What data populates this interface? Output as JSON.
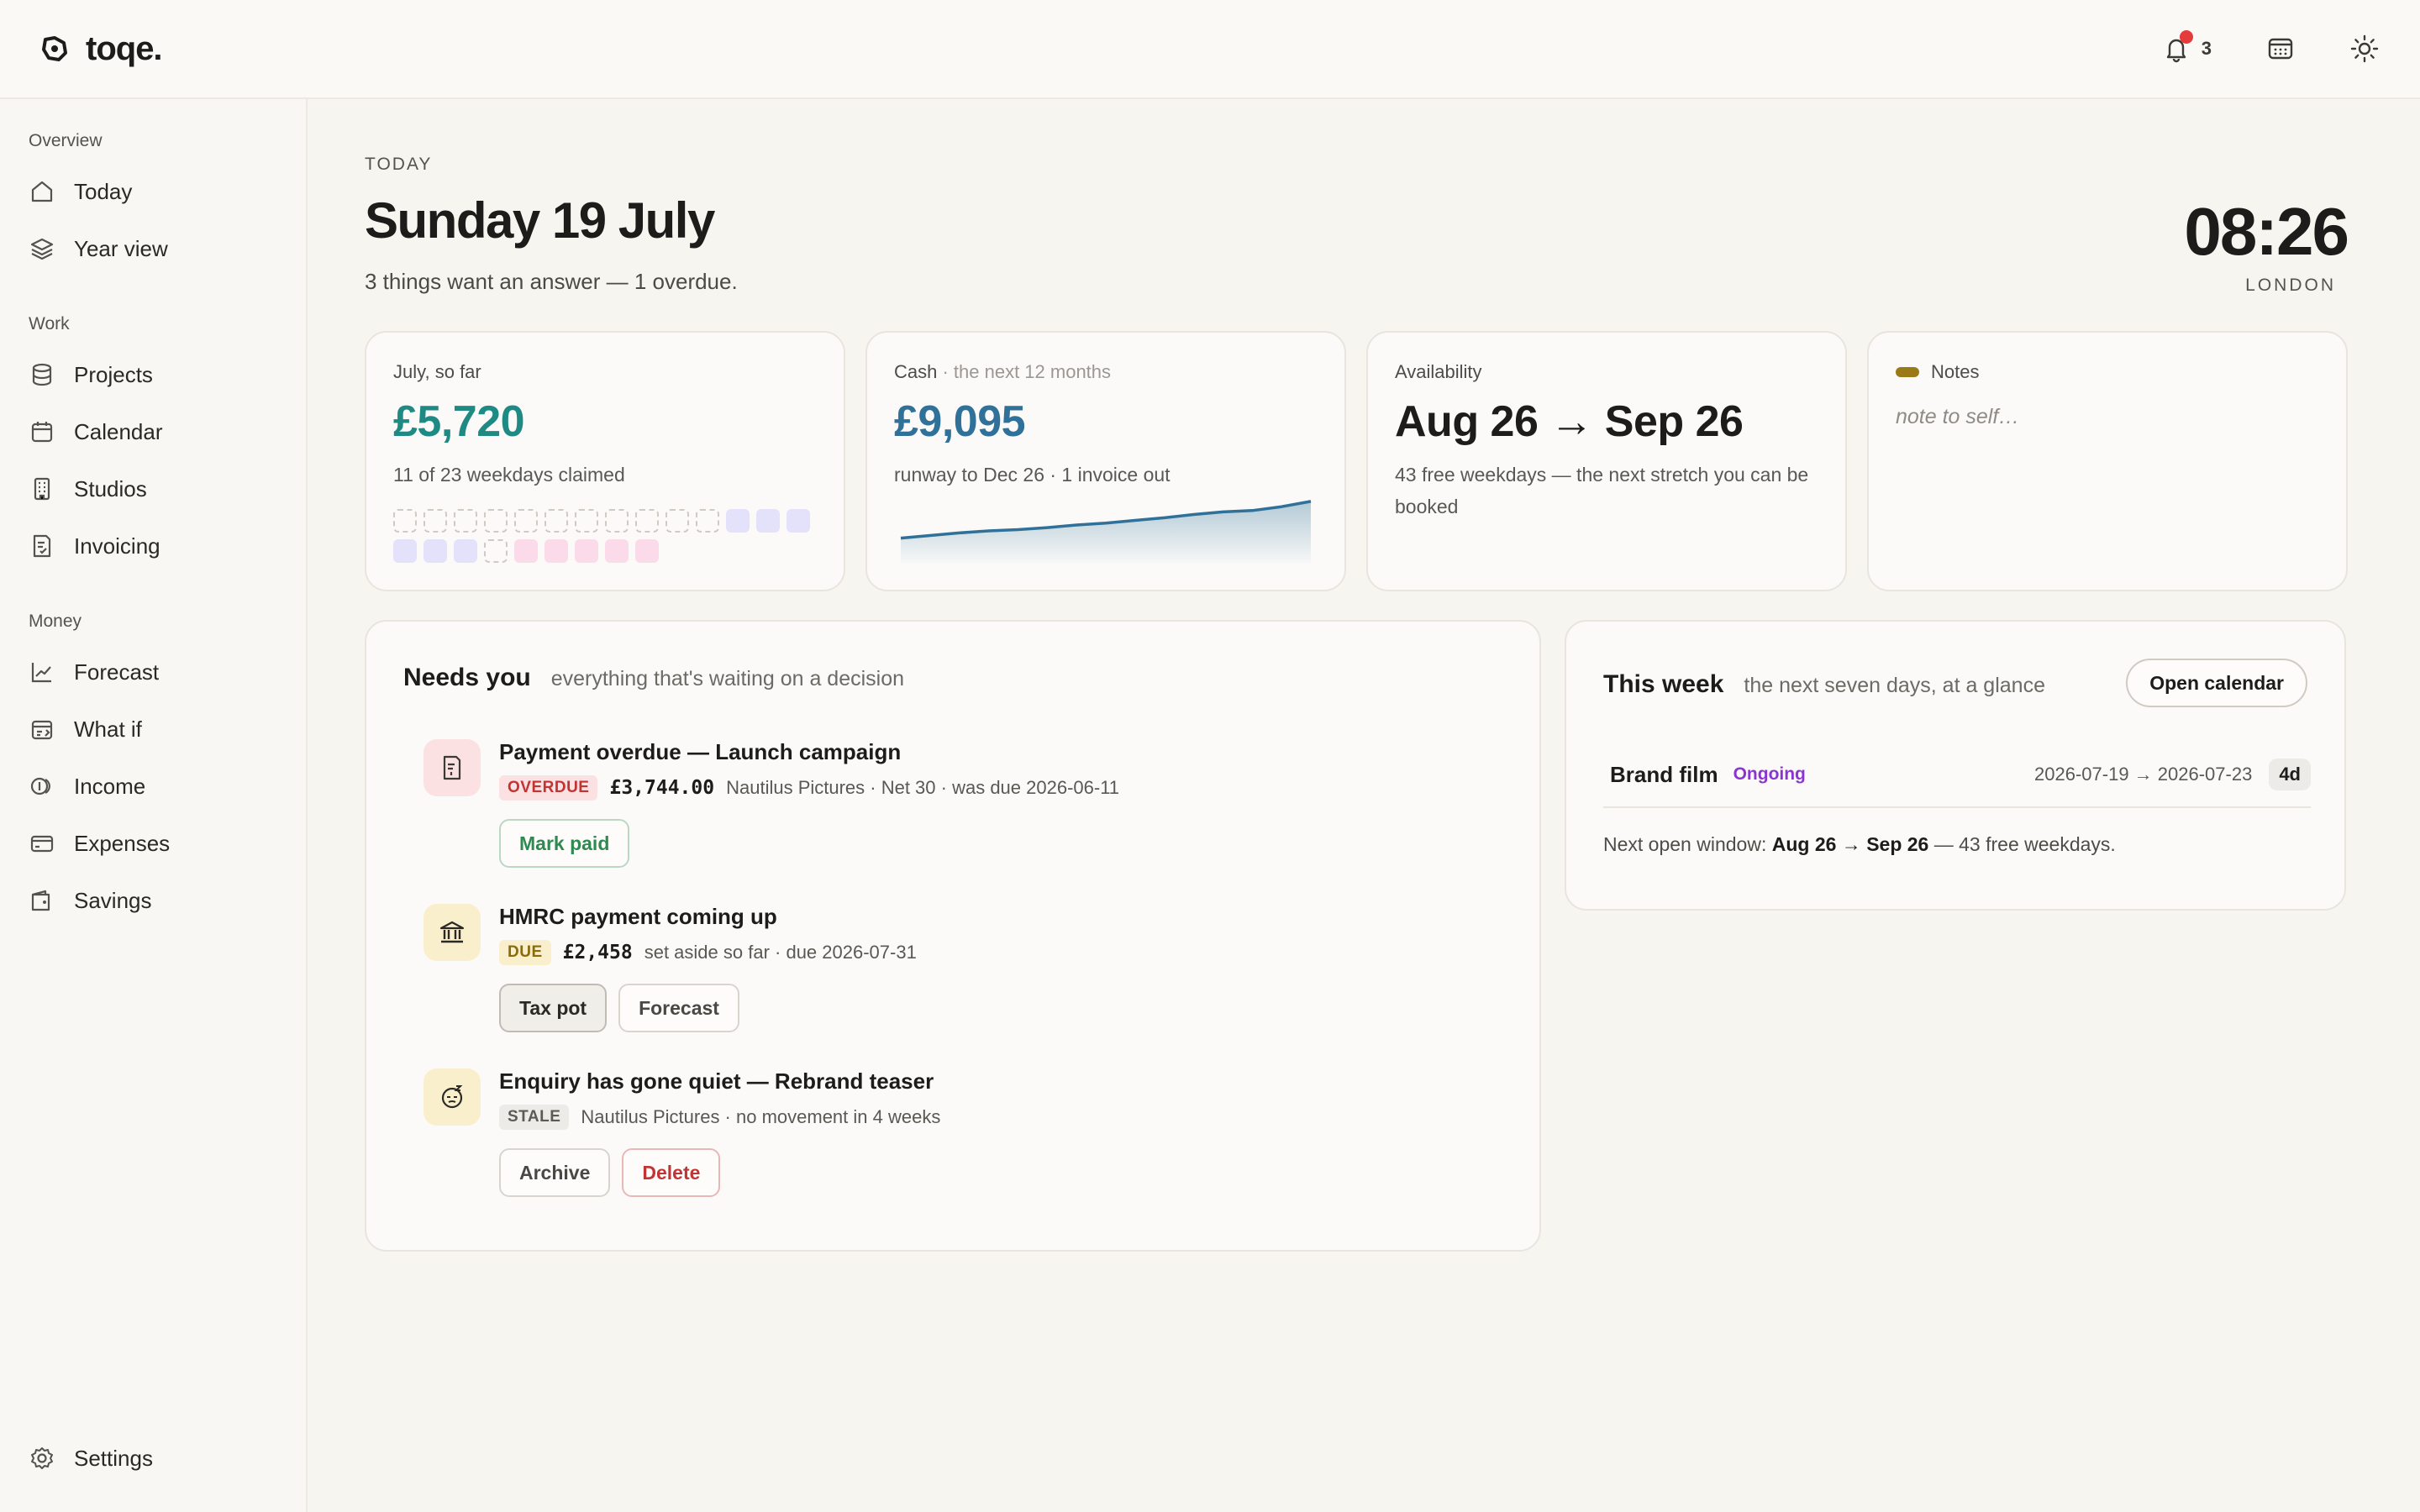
{
  "app": {
    "name": "toqe."
  },
  "topbar": {
    "notifications_count": "3"
  },
  "sidebar": {
    "sections": [
      {
        "title": "Overview",
        "items": [
          "Today",
          "Year view"
        ]
      },
      {
        "title": "Work",
        "items": [
          "Projects",
          "Calendar",
          "Studios",
          "Invoicing"
        ]
      },
      {
        "title": "Money",
        "items": [
          "Forecast",
          "What if",
          "Income",
          "Expenses",
          "Savings"
        ]
      }
    ],
    "settings": "Settings"
  },
  "header": {
    "eyebrow": "TODAY",
    "title": "Sunday 19 July",
    "subtitle": "3 things want an answer — 1 overdue.",
    "clock": "08:26",
    "city": "LONDON"
  },
  "stats": {
    "july": {
      "label": "July, so far",
      "value": "£5,720",
      "note": "11 of 23 weekdays claimed",
      "color": "#1f8a84"
    },
    "cash": {
      "label": "Cash",
      "label_muted": " · the next 12 months",
      "value": "£9,095",
      "note": "runway to Dec 26 · 1 invoice out",
      "color": "#2f7199"
    },
    "availability": {
      "label": "Availability",
      "value": "Aug 26 → Sep 26",
      "note": "43 free weekdays — the next stretch you can be booked"
    },
    "notes": {
      "label": "Notes",
      "placeholder": "note to self…"
    }
  },
  "cash_trend": [
    0.3,
    0.34,
    0.38,
    0.41,
    0.43,
    0.46,
    0.5,
    0.53,
    0.57,
    0.61,
    0.66,
    0.7,
    0.72,
    0.78,
    0.86
  ],
  "needs": {
    "title": "Needs you",
    "subtitle": "everything that's waiting on a decision",
    "items": [
      {
        "title": "Payment overdue — Launch campaign",
        "badge": "OVERDUE",
        "amount": "£3,744.00",
        "meta": "Nautilus Pictures · Net 30 · was due 2026-06-11",
        "buttons": [
          "Mark paid"
        ]
      },
      {
        "title": "HMRC payment coming up",
        "badge": "DUE",
        "amount": "£2,458",
        "meta": "set aside so far · due 2026-07-31",
        "buttons": [
          "Tax pot",
          "Forecast"
        ]
      },
      {
        "title": "Enquiry has gone quiet — Rebrand teaser",
        "badge": "STALE",
        "amount": "",
        "meta": "Nautilus Pictures · no movement in 4 weeks",
        "buttons": [
          "Archive",
          "Delete"
        ]
      }
    ]
  },
  "week": {
    "title": "This week",
    "subtitle": "the next seven days, at a glance",
    "open_button": "Open calendar",
    "project": {
      "name": "Brand film",
      "status": "Ongoing",
      "dates": "2026-07-19 → 2026-07-23",
      "duration": "4d"
    },
    "foot_prefix": "Next open window: ",
    "foot_window": "Aug 26 → Sep 26",
    "foot_suffix": " — 43 free weekdays."
  }
}
